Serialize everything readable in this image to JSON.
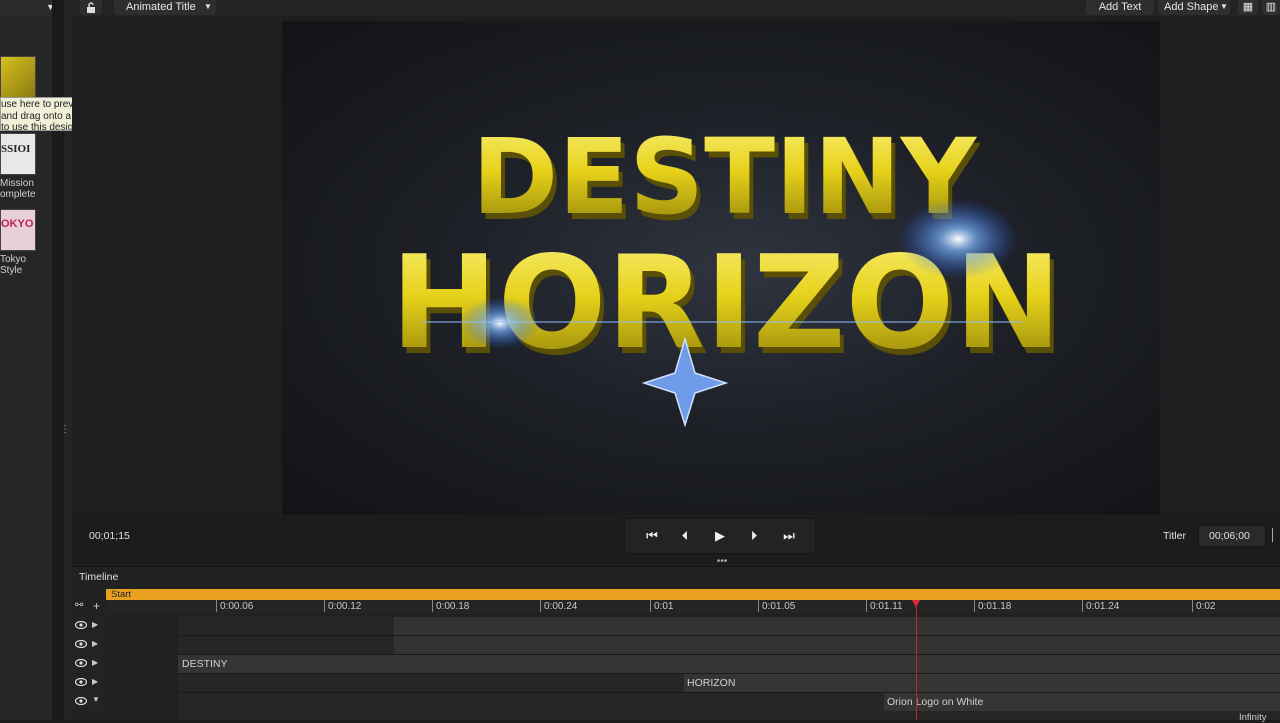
{
  "toolbar": {
    "title_dropdown": "Animated Title",
    "add_text": "Add Text",
    "add_shape": "Add Shape"
  },
  "design_panel": {
    "tooltip_lines": [
      "use here to preview the Title design.",
      "and drag onto a Title in the Play list",
      "to use this design."
    ],
    "items": [
      {
        "label": "Mission\nComplete",
        "label_l1": "Mission",
        "label_l2": "omplete",
        "thumb_text": "SSIOI"
      },
      {
        "label": "Tokyo Style",
        "label_l1": "Tokyo",
        "label_l2": "Style",
        "thumb_text": "OKYO"
      }
    ]
  },
  "preview": {
    "title_line1": "DESTINY",
    "title_line2": "HORIZON"
  },
  "transport": {
    "current_time": "00;01;15",
    "mode_label": "Titler",
    "duration": "00;06;00"
  },
  "timeline": {
    "label": "Timeline",
    "start_marker": "Start",
    "ticks": [
      "0:00.06",
      "0:00.12",
      "0:00.18",
      "0:00.24",
      "0:01",
      "0:01.05",
      "0:01.11",
      "0:01.18",
      "0:01.24",
      "0:02"
    ],
    "tracks": [
      {
        "name": "",
        "clip": ""
      },
      {
        "name": "",
        "clip": ""
      },
      {
        "name": "DESTINY",
        "clip": ""
      },
      {
        "name": "",
        "clip": "HORIZON"
      },
      {
        "name": "",
        "clip": "Orion Logo on White"
      }
    ],
    "infinity_label": "Infinity"
  },
  "colors": {
    "accent_orange": "#e8a020",
    "playhead": "#d02030",
    "title_gold": "#e6d21a"
  }
}
